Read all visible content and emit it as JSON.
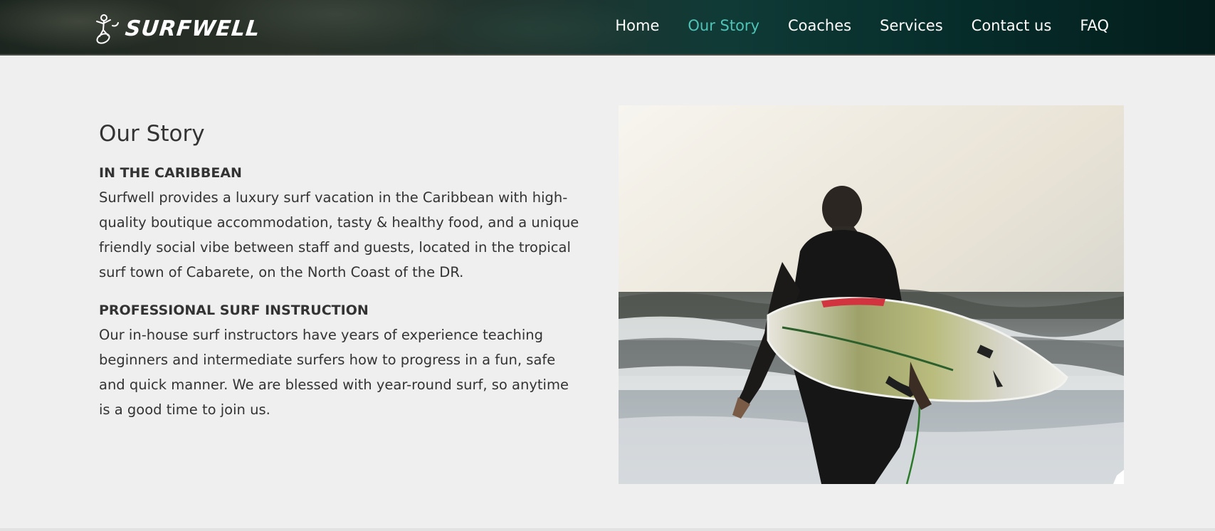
{
  "header": {
    "logo_text": "SURFWELL",
    "nav": [
      {
        "label": "Home",
        "active": false
      },
      {
        "label": "Our Story",
        "active": true
      },
      {
        "label": "Coaches",
        "active": false
      },
      {
        "label": "Services",
        "active": false
      },
      {
        "label": "Contact us",
        "active": false
      },
      {
        "label": "FAQ",
        "active": false
      }
    ],
    "active_color": "#4fc3b6"
  },
  "main": {
    "title": "Our Story",
    "sections": [
      {
        "heading": "IN THE CARIBBEAN",
        "body": "Surfwell provides a luxury surf vacation in the Caribbean with high-quality boutique accommodation, tasty & healthy food, and a unique friendly social vibe between staff and guests, located in the tropical surf town of Cabarete, on the North Coast of the DR."
      },
      {
        "heading": "PROFESSIONAL SURF INSTRUCTION",
        "body": "Our in-house surf instructors have years of experience teaching beginners and intermediate surfers how to progress in a fun, safe and quick manner. We are blessed with year-round surf, so anytime is a good time to join us."
      }
    ],
    "photo": {
      "icon": "surfer-photo"
    }
  }
}
